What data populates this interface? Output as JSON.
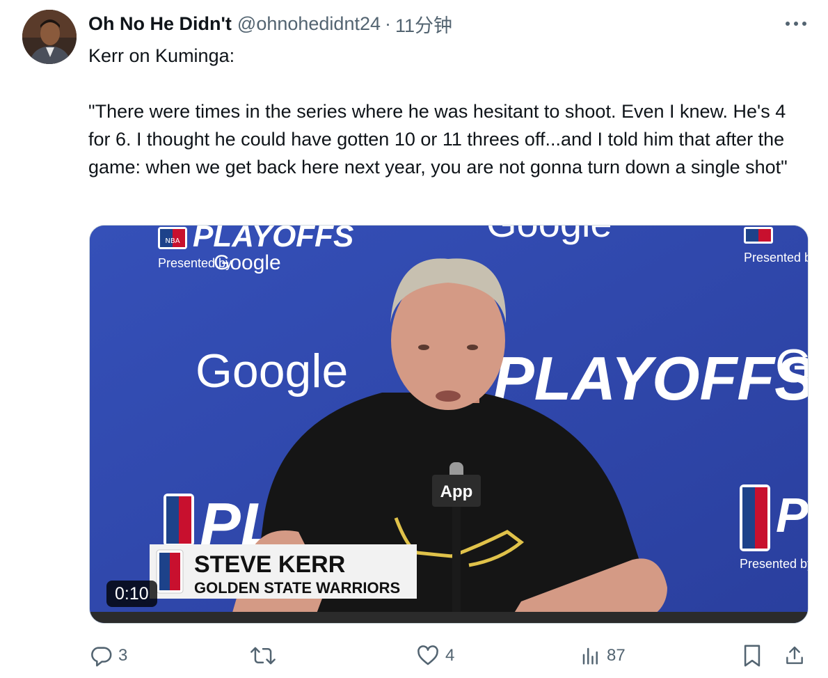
{
  "tweet": {
    "author_name": "Oh No He Didn't",
    "handle": "@ohnohedidnt24",
    "separator": "·",
    "time": "11分钟",
    "text": "Kerr on Kuminga:\n\n\"There were times in the series where he was hesitant to shoot. Even I knew. He's 4 for 6. I thought he could have gotten 10 or 11 threes off...and I told him that after the game: when we get back here next year, you are not gonna turn down a single shot\""
  },
  "video": {
    "duration": "0:10",
    "lower_third_name": "STEVE KERR",
    "lower_third_team": "GOLDEN STATE WARRIORS",
    "backdrop_playoffs": "PLAYOFFS",
    "backdrop_google": "Google",
    "backdrop_presented": "Presented by",
    "mic_flag": "App",
    "nba_mark": "NBA"
  },
  "actions": {
    "replies": "3",
    "retweets": "",
    "likes": "4",
    "views": "87"
  },
  "icons": {
    "more": "more-horizontal-icon",
    "reply": "reply-icon",
    "retweet": "retweet-icon",
    "like": "heart-icon",
    "views": "views-chart-icon",
    "bookmark": "bookmark-icon",
    "share": "share-icon"
  },
  "colors": {
    "text": "#0f1419",
    "secondary": "#536471",
    "backdrop_blue": "#2e44a8"
  }
}
